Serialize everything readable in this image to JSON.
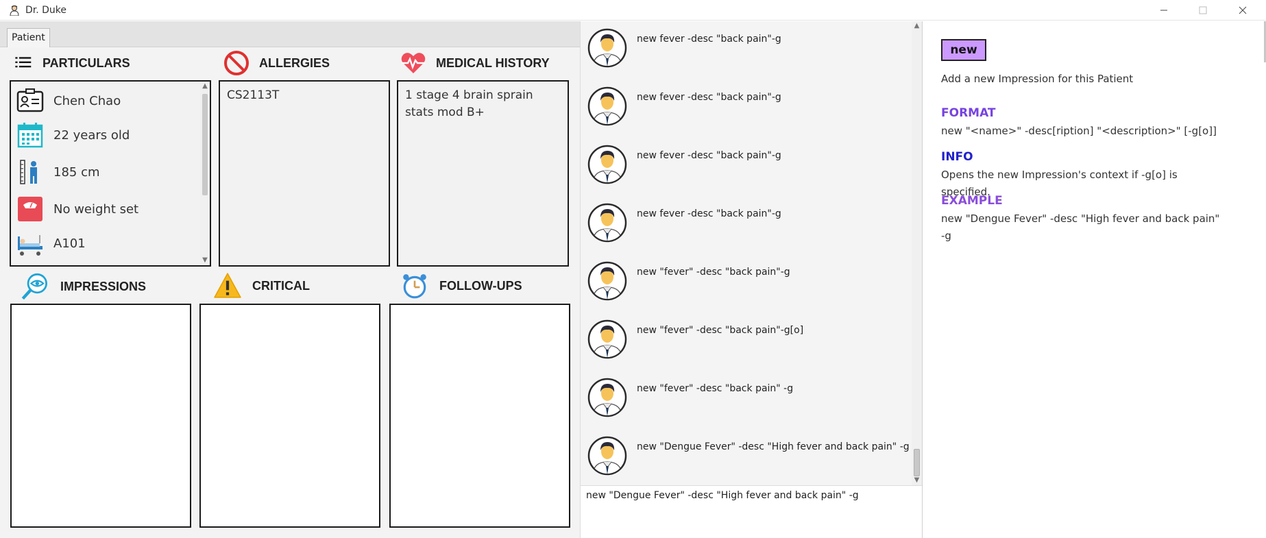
{
  "window": {
    "title": "Dr. Duke"
  },
  "tabs": [
    {
      "label": "Patient"
    }
  ],
  "sections": {
    "particulars": {
      "title": "PARTICULARS"
    },
    "allergies": {
      "title": "ALLERGIES",
      "content": "CS2113T"
    },
    "medical_history": {
      "title": "MEDICAL HISTORY",
      "lines": [
        "1 stage 4 brain sprain",
        "stats mod B+"
      ]
    },
    "impressions": {
      "title": "IMPRESSIONS"
    },
    "critical": {
      "title": "CRITICAL"
    },
    "follow_ups": {
      "title": "FOLLOW-UPS"
    }
  },
  "particulars": {
    "name": "Chen Chao",
    "age": "22 years old",
    "height": "185 cm",
    "weight": "No weight set",
    "bed": "A101"
  },
  "chat": {
    "messages": [
      "new fever -desc \"back pain\"-g",
      "new fever -desc \"back pain\"-g",
      "new fever -desc \"back pain\"-g",
      "new fever -desc \"back pain\"-g",
      "new \"fever\" -desc \"back pain\"-g",
      "new \"fever\" -desc \"back pain\"-g[o]",
      "new \"fever\" -desc \"back pain\" -g",
      "new \"Dengue Fever\" -desc \"High fever and back pain\" -g"
    ]
  },
  "command_input": {
    "value": "new \"Dengue Fever\" -desc \"High fever and back pain\" -g"
  },
  "help": {
    "command": "new",
    "description": "Add a new Impression for this Patient",
    "format_title": "FORMAT",
    "format_text": "new \"<name>\" -desc[ription] \"<description>\" [-g[o]]",
    "info_title": "INFO",
    "info_text": "Opens the new Impression's context if -g[o] is specified.",
    "example_title": "EXAMPLE",
    "example_line1": "new \"Dengue Fever\" -desc \"High fever and back pain\"",
    "example_line2": "-g"
  },
  "colors": {
    "command_badge": "#cc99ff",
    "format_heading": "#7744e0",
    "info_heading": "#2222cc",
    "example_heading": "#8a4ddb"
  }
}
